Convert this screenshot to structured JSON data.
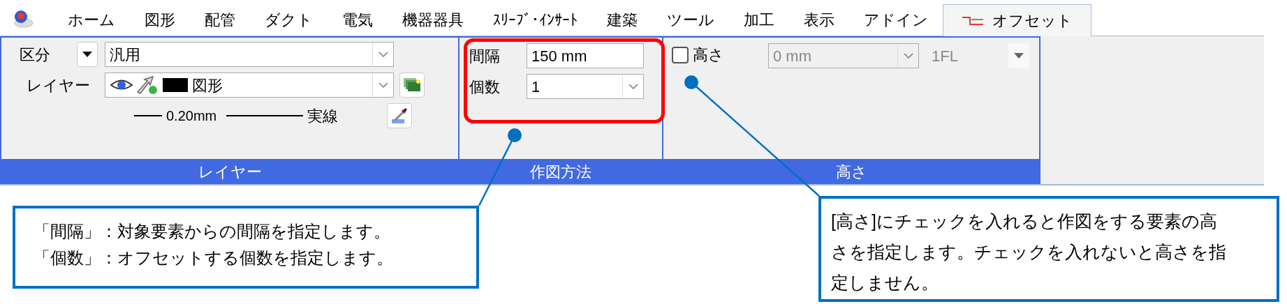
{
  "tabs": [
    {
      "label": "ホーム",
      "selected": false
    },
    {
      "label": "図形",
      "selected": false
    },
    {
      "label": "配管",
      "selected": false
    },
    {
      "label": "ダクト",
      "selected": false
    },
    {
      "label": "電気",
      "selected": false
    },
    {
      "label": "機器器具",
      "selected": false
    },
    {
      "label": "ｽﾘｰﾌﾞ･ｲﾝｻｰﾄ",
      "selected": false
    },
    {
      "label": "建築",
      "selected": false
    },
    {
      "label": "ツール",
      "selected": false
    },
    {
      "label": "加工",
      "selected": false
    },
    {
      "label": "表示",
      "selected": false
    },
    {
      "label": "アドイン",
      "selected": false
    },
    {
      "label": "オフセット",
      "selected": true
    }
  ],
  "layer_group": {
    "title": "レイヤー",
    "category_label": "区分",
    "category_value": "汎用",
    "layer_label": "レイヤー",
    "layer_value": "図形",
    "line_width": "0.20mm",
    "line_type": "実線"
  },
  "drawing_method_group": {
    "title": "作図方法",
    "spacing_label": "間隔",
    "spacing_value": "150 mm",
    "count_label": "個数",
    "count_value": "1"
  },
  "height_group": {
    "title": "高さ",
    "checkbox_label": "高さ",
    "checked": false,
    "height_value": "0 mm",
    "disabled": true,
    "floor": "1FL"
  },
  "callouts": [
    {
      "lines": [
        "「間隔」：対象要素からの間隔を指定します。",
        "「個数」：オフセットする個数を指定します。"
      ]
    },
    {
      "lines": [
        "[高さ]にチェックを入れると作図をする要素の高",
        "さを指定します。チェックを入れないと高さを指",
        "定しません。"
      ]
    }
  ]
}
